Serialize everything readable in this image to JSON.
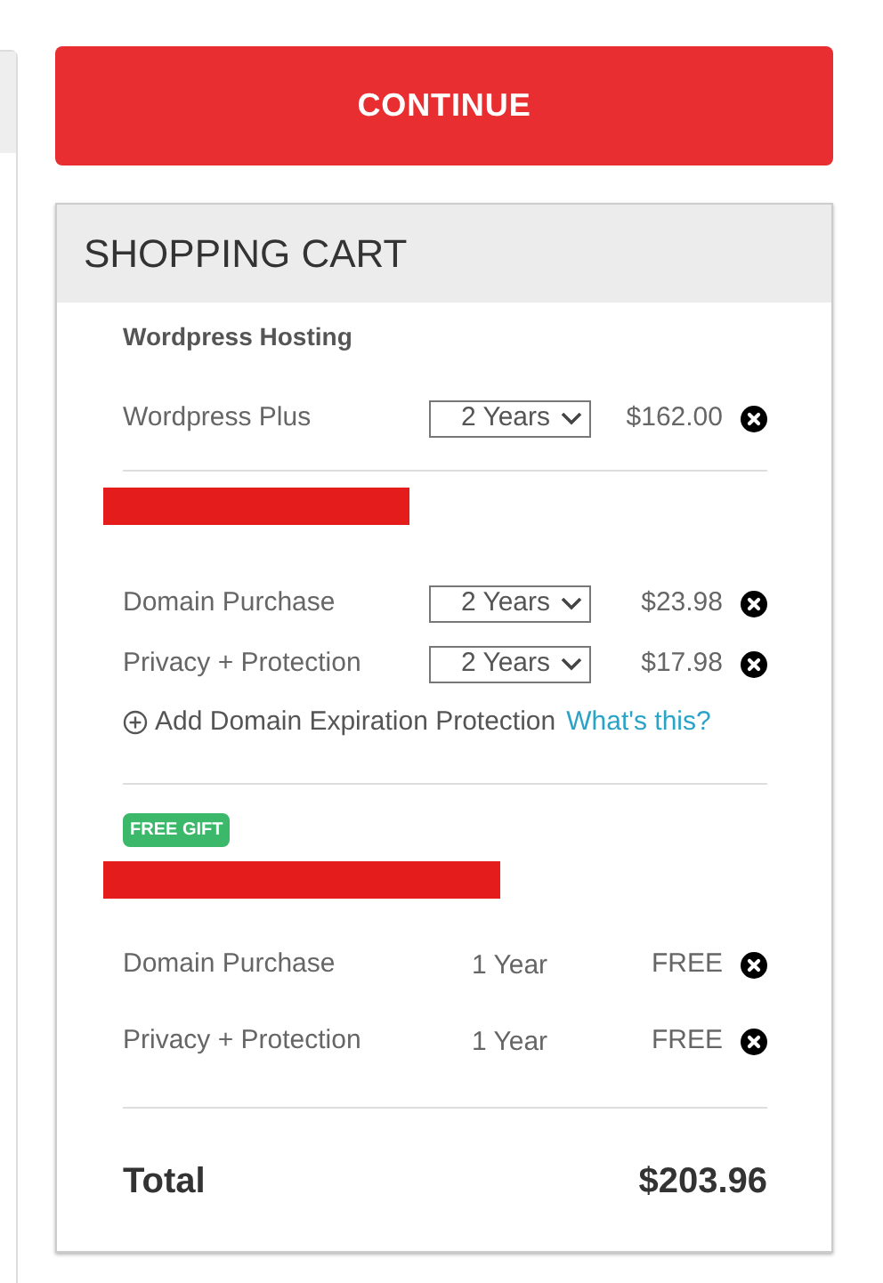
{
  "continue_button": "CONTINUE",
  "cart": {
    "title": "SHOPPING CART",
    "sections": [
      {
        "heading": "Wordpress Hosting",
        "items": [
          {
            "kind": "select",
            "name": "Wordpress Plus",
            "term": "2 Years",
            "price": "$162.00"
          }
        ]
      },
      {
        "redacted": true,
        "items": [
          {
            "kind": "select",
            "name": "Domain Purchase",
            "term": "2 Years",
            "price": "$23.98"
          },
          {
            "kind": "select",
            "name": "Privacy + Protection",
            "term": "2 Years",
            "price": "$17.98"
          }
        ],
        "addon": {
          "label": "Add Domain Expiration Protection",
          "link": "What's this?"
        }
      },
      {
        "badge": "FREE GIFT",
        "redacted": true,
        "items": [
          {
            "kind": "plain",
            "name": "Domain Purchase",
            "term": "1 Year",
            "price": "FREE"
          },
          {
            "kind": "plain",
            "name": "Privacy + Protection",
            "term": "1 Year",
            "price": "FREE"
          }
        ]
      }
    ],
    "total": {
      "label": "Total",
      "amount": "$203.96"
    }
  }
}
